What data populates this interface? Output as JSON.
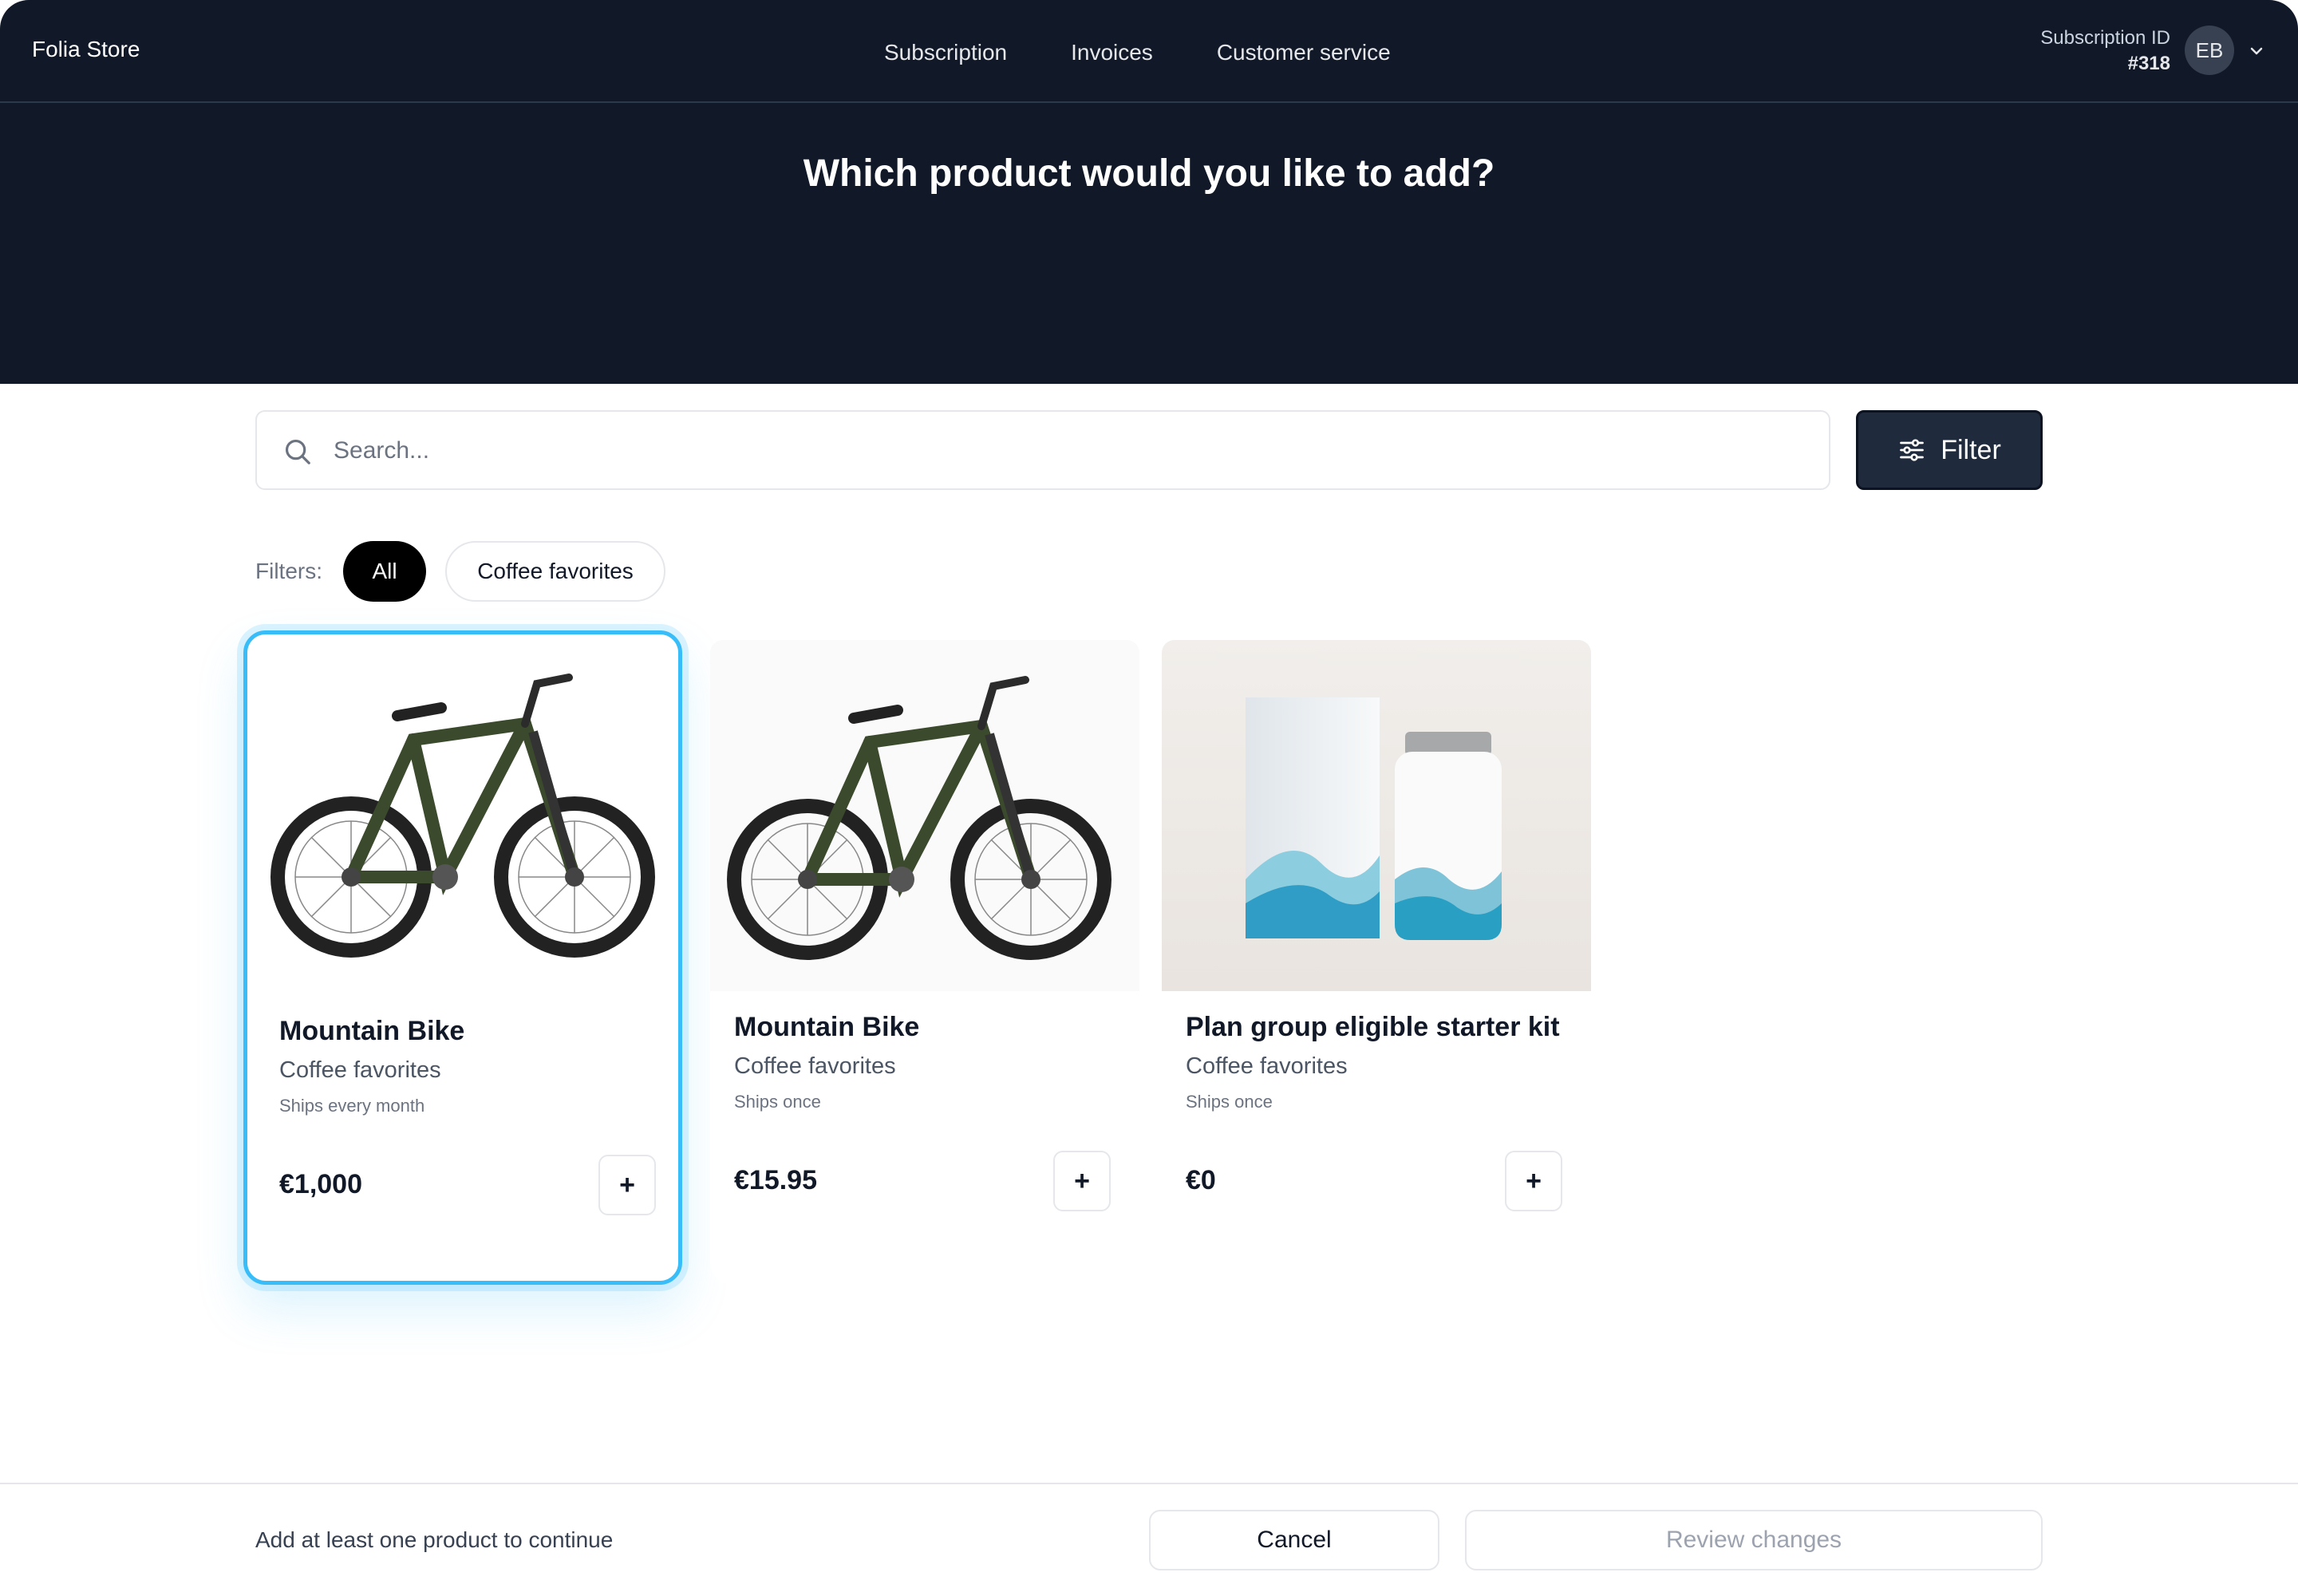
{
  "header": {
    "brand": "Folia Store",
    "nav": [
      "Subscription",
      "Invoices",
      "Customer service"
    ],
    "subscription_label": "Subscription ID",
    "subscription_id": "#318",
    "avatar_initials": "EB"
  },
  "hero": {
    "title": "Which product would you like to add?"
  },
  "search": {
    "placeholder": "Search...",
    "value": ""
  },
  "filter_button": {
    "label": "Filter"
  },
  "filters": {
    "label": "Filters:",
    "chips": [
      {
        "label": "All",
        "active": true
      },
      {
        "label": "Coffee favorites",
        "active": false
      }
    ]
  },
  "products": [
    {
      "name": "Mountain Bike",
      "category": "Coffee favorites",
      "shipping": "Ships every month",
      "price": "€1,000",
      "add_label": "+",
      "image": "bike",
      "selected": true
    },
    {
      "name": "Mountain Bike",
      "category": "Coffee favorites",
      "shipping": "Ships once",
      "price": "€15.95",
      "add_label": "+",
      "image": "bike",
      "selected": false
    },
    {
      "name": "Plan group eligible starter kit",
      "category": "Coffee favorites",
      "shipping": "Ships once",
      "price": "€0",
      "add_label": "+",
      "image": "starter-kit",
      "selected": false
    }
  ],
  "footer": {
    "message": "Add at least one product to continue",
    "cancel_label": "Cancel",
    "review_label": "Review changes",
    "review_enabled": false
  },
  "colors": {
    "header_bg": "#111827",
    "accent_selected": "#38bdf8",
    "filter_button_bg": "#1f2a3c",
    "chip_active_bg": "#000000"
  }
}
